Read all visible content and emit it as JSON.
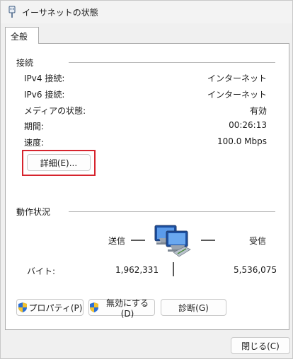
{
  "window": {
    "title": "イーサネットの状態",
    "icon": "ethernet-plug-icon"
  },
  "tabs": [
    {
      "label": "全般",
      "selected": true
    }
  ],
  "connection": {
    "group_label": "接続",
    "rows": [
      {
        "label": "IPv4 接続:",
        "value": "インターネット"
      },
      {
        "label": "IPv6 接続:",
        "value": "インターネット"
      },
      {
        "label": "メディアの状態:",
        "value": "有効"
      },
      {
        "label": "期間:",
        "value": "00:26:13"
      },
      {
        "label": "速度:",
        "value": "100.0 Mbps"
      }
    ],
    "details_button": "詳細(E)..."
  },
  "activity": {
    "group_label": "動作状況",
    "sent_label": "送信",
    "received_label": "受信",
    "bytes_label": "バイト:",
    "bytes_sent": "1,962,331",
    "bytes_received": "5,536,075",
    "icon": "network-computers-icon"
  },
  "actions": {
    "properties": "プロパティ(P)",
    "disable": "無効にする(D)",
    "diagnose": "診断(G)"
  },
  "footer": {
    "close": "閉じる(C)"
  },
  "colors": {
    "highlight": "#d6242d",
    "shield_blue": "#2a6fd6",
    "shield_yellow": "#f2c230"
  }
}
